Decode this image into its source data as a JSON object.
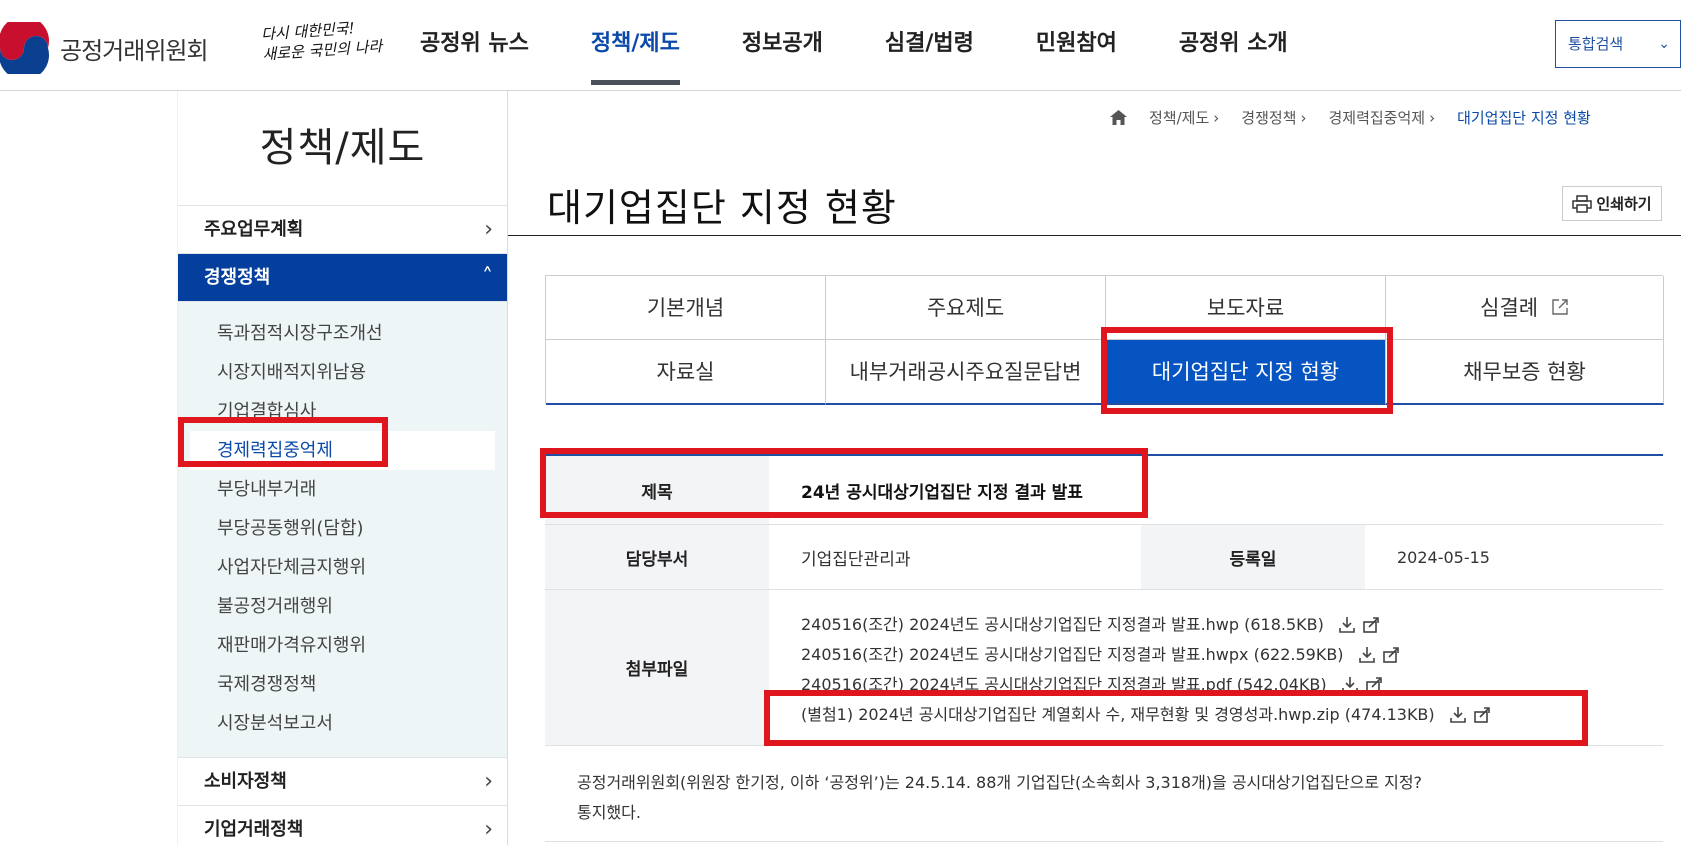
{
  "header": {
    "logo_text": "공정거래위원회",
    "slogan_line1": "다시 대한민국!",
    "slogan_line2": "새로운 국민의 나라",
    "nav": [
      "공정위 뉴스",
      "정책/제도",
      "정보공개",
      "심결/법령",
      "민원참여",
      "공정위 소개"
    ],
    "search_select": "통합검색"
  },
  "sidebar": {
    "title": "정책/제도",
    "items": [
      {
        "label": "주요업무계획"
      },
      {
        "label": "경쟁정책"
      },
      {
        "label": "소비자정책"
      },
      {
        "label": "기업거래정책"
      }
    ],
    "subitems": [
      "독과점적시장구조개선",
      "시장지배적지위남용",
      "기업결합심사",
      "경제력집중억제",
      "부당내부거래",
      "부당공동행위(담합)",
      "사업자단체금지행위",
      "불공정거래행위",
      "재판매가격유지행위",
      "국제경쟁정책",
      "시장분석보고서"
    ]
  },
  "breadcrumb": [
    "정책/제도",
    "경쟁정책",
    "경제력집중억제",
    "대기업집단 지정 현황"
  ],
  "page": {
    "title": "대기업집단 지정 현황",
    "print_label": "인쇄하기"
  },
  "tabs": [
    "기본개념",
    "주요제도",
    "보도자료",
    "심결례",
    "자료실",
    "내부거래공시주요질문답변",
    "대기업집단 지정 현황",
    "채무보증 현황"
  ],
  "detail": {
    "title_label": "제목",
    "title_value": "24년 공시대상기업집단 지정 결과 발표",
    "dept_label": "담당부서",
    "dept_value": "기업집단관리과",
    "date_label": "등록일",
    "date_value": "2024-05-15",
    "files_label": "첨부파일",
    "files": [
      "240516(조간) 2024년도 공시대상기업집단 지정결과 발표.hwp (618.5KB)",
      "240516(조간) 2024년도 공시대상기업집단 지정결과 발표.hwpx (622.59KB)",
      "240516(조간) 2024년도 공시대상기업집단 지정결과 발표.pdf (542.04KB)",
      "(별첨1) 2024년 공시대상기업집단 계열회사 수, 재무현황 및 경영성과.hwp.zip (474.13KB)"
    ],
    "content_line1": "공정거래위원회(위원장 한기정, 이하 ‘공정위’)는 24.5.14. 88개 기업집단(소속회사 3,318개)을 공시대상기업집단으로 지정?",
    "content_line2": "통지했다."
  },
  "colors": {
    "accent": "#0554c2",
    "nav_active": "#053f9e",
    "highlight": "#e0161f"
  }
}
